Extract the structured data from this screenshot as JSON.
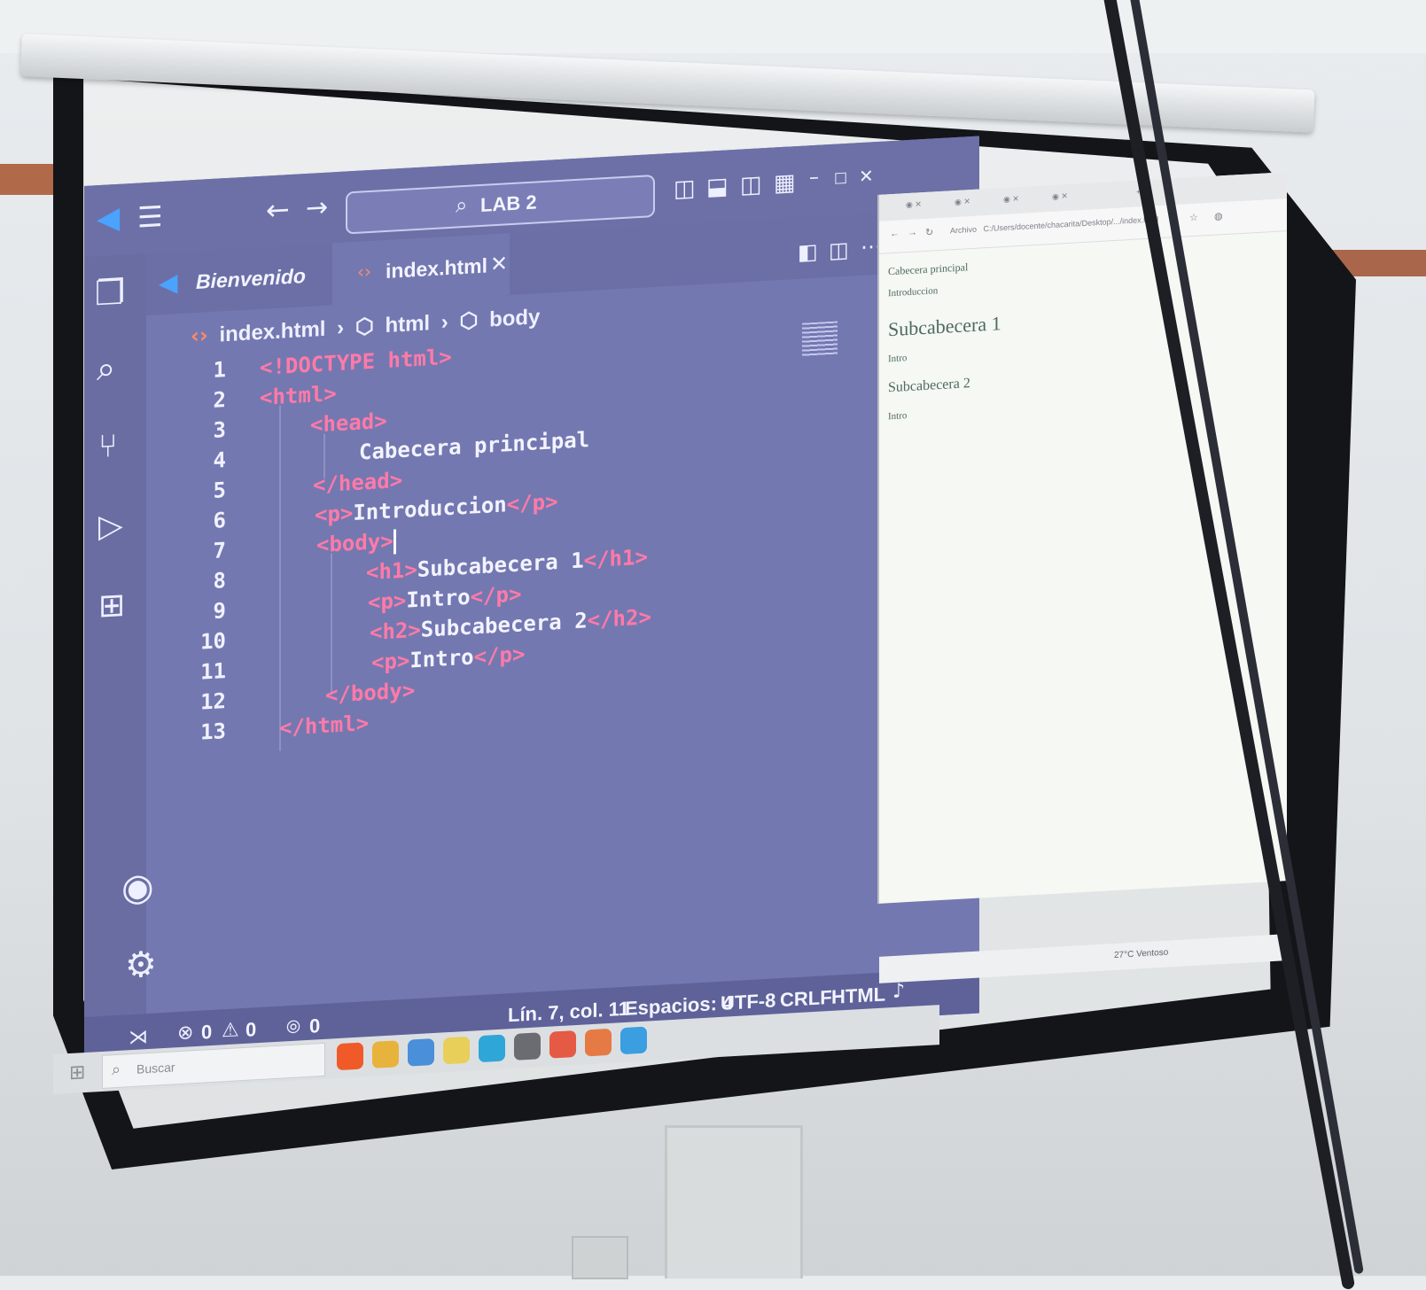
{
  "titlebar": {
    "search_label": "LAB 2",
    "back_glyph": "←",
    "forward_glyph": "→"
  },
  "tabs": [
    {
      "label": "Bienvenido"
    },
    {
      "label": "index.html"
    }
  ],
  "breadcrumb": {
    "file": "index.html",
    "node1": "html",
    "node2": "body"
  },
  "code": {
    "lines": [
      {
        "n": "1",
        "text": "<!DOCTYPE html>"
      },
      {
        "n": "2",
        "text": "<html>"
      },
      {
        "n": "3",
        "text": "<head>"
      },
      {
        "n": "4",
        "text": "Cabecera principal"
      },
      {
        "n": "5",
        "text": "</head>"
      },
      {
        "n": "6",
        "open": "<p>",
        "inner": "Introduccion",
        "close": "</p>"
      },
      {
        "n": "7",
        "text": "<body>"
      },
      {
        "n": "8",
        "open": "<h1>",
        "inner": "Subcabecera 1",
        "close": "</h1>"
      },
      {
        "n": "9",
        "open": "<p>",
        "inner": "Intro",
        "close": "</p>"
      },
      {
        "n": "10",
        "open": "<h2>",
        "inner": "Subcabecera 2",
        "close": "</h2>"
      },
      {
        "n": "11",
        "open": "<p>",
        "inner": "Intro",
        "close": "</p>"
      },
      {
        "n": "12",
        "text": "</body>"
      },
      {
        "n": "13",
        "text": "</html>"
      }
    ]
  },
  "statusbar": {
    "errors": "0",
    "warnings": "0",
    "ports": "0",
    "position": "Lín. 7, col. 11",
    "spaces": "Espacios: 4",
    "encoding": "UTF-8",
    "eol": "CRLF",
    "language": "HTML"
  },
  "browser": {
    "url": "C:/Users/docente/chacarita/Desktop/.../index.html",
    "address_prefix": "Archivo",
    "content": {
      "p1": "Cabecera principal",
      "p2": "Introduccion",
      "h1": "Subcabecera 1",
      "p3": "Intro",
      "h2": "Subcabecera 2",
      "p4": "Intro"
    },
    "tray_weather": "27°C Ventoso"
  },
  "taskbar": {
    "search_placeholder": "Buscar"
  },
  "colors": {
    "editor_bg": "#7478b0",
    "tag": "#ff7aa8",
    "browser_text": "#4f6a60"
  }
}
